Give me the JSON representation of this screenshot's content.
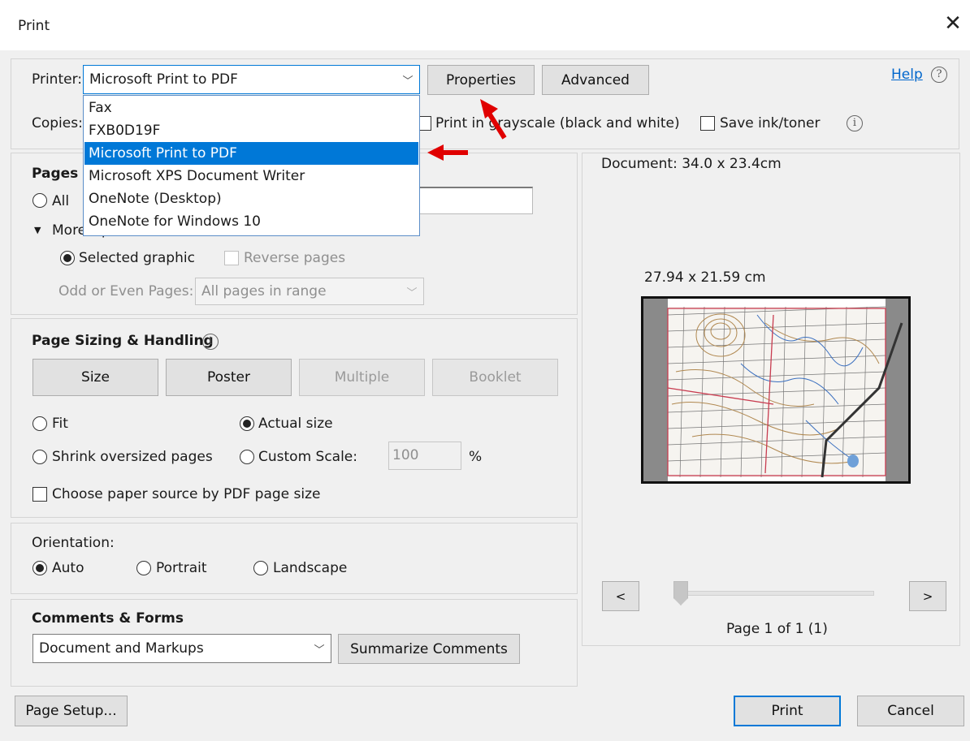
{
  "window": {
    "title": "Print"
  },
  "printer": {
    "label": "Printer:",
    "selected": "Microsoft Print to PDF",
    "properties_button": "Properties",
    "advanced_button": "Advanced",
    "help_link": "Help",
    "options": [
      "Fax",
      "FXB0D19F",
      "Microsoft Print to PDF",
      "Microsoft XPS Document Writer",
      "OneNote (Desktop)",
      "OneNote for Windows 10"
    ]
  },
  "copies": {
    "label": "Copies:",
    "grayscale_label": "Print in grayscale (black and white)",
    "save_ink_label": "Save ink/toner"
  },
  "pages": {
    "title": "Pages t",
    "all_label": "All",
    "more_options": "More Options",
    "selected_graphic": "Selected graphic",
    "reverse_pages": "Reverse pages",
    "odd_even_label": "Odd or Even Pages:",
    "odd_even_value": "All pages in range"
  },
  "sizing": {
    "title": "Page Sizing & Handling",
    "tabs": [
      "Size",
      "Poster",
      "Multiple",
      "Booklet"
    ],
    "fit": "Fit",
    "actual_size": "Actual size",
    "shrink": "Shrink oversized pages",
    "custom_scale": "Custom Scale:",
    "scale_value": "100",
    "percent": "%",
    "paper_source": "Choose paper source by PDF page size"
  },
  "orientation": {
    "title": "Orientation:",
    "auto": "Auto",
    "portrait": "Portrait",
    "landscape": "Landscape"
  },
  "comments": {
    "title": "Comments & Forms",
    "value": "Document and Markups",
    "summarize": "Summarize Comments"
  },
  "preview": {
    "document_size": "Document: 34.0 x 23.4cm",
    "paper_size": "27.94 x 21.59 cm",
    "prev": "<",
    "next": ">",
    "page_indicator": "Page 1 of 1 (1)"
  },
  "footer": {
    "page_setup": "Page Setup...",
    "print": "Print",
    "cancel": "Cancel"
  },
  "colors": {
    "accent": "#0078d7",
    "annotation_arrow": "#e00000",
    "link": "#0066cc"
  }
}
